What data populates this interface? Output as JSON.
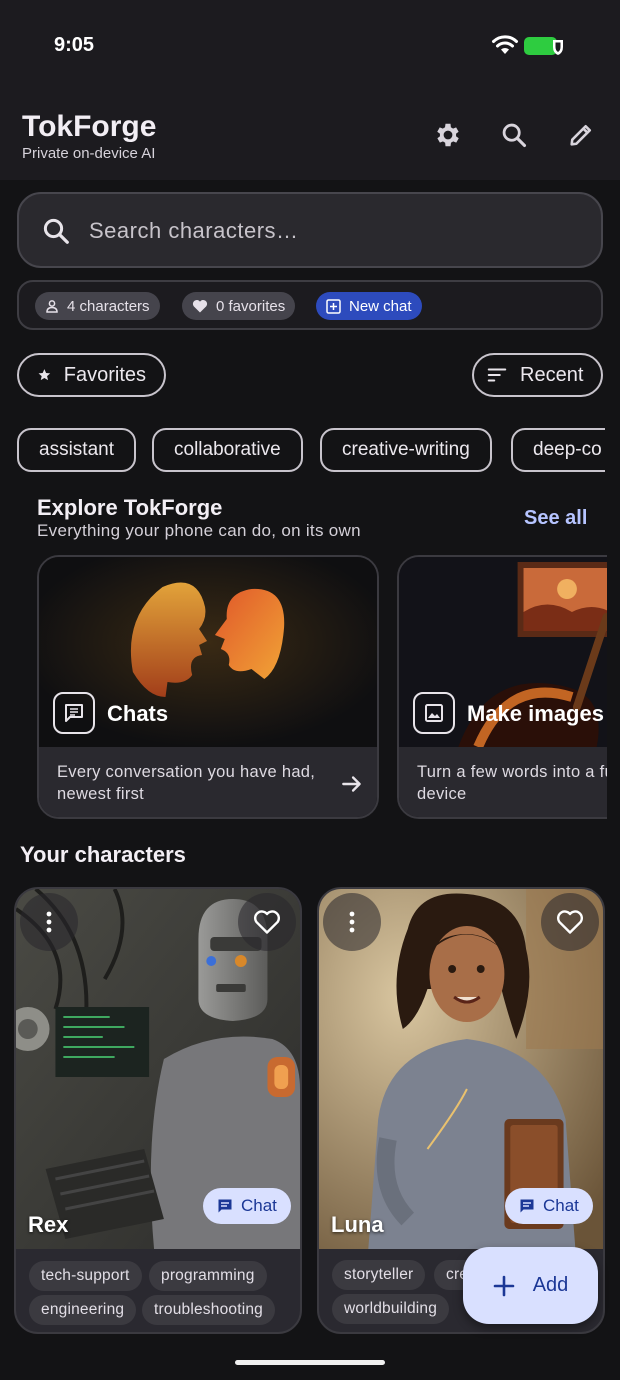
{
  "status_bar": {
    "time": "9:05"
  },
  "app_bar": {
    "title": "TokForge",
    "subtitle": "Private on-device AI",
    "actions": [
      "gear-icon",
      "search-icon",
      "edit-icon"
    ]
  },
  "search": {
    "placeholder": "Search characters…"
  },
  "stats": {
    "characters": "4 characters",
    "favorites": "0 favorites",
    "new_chat": "New chat"
  },
  "filters": {
    "favorites": "Favorites",
    "sort": "Recent"
  },
  "tags": [
    "assistant",
    "collaborative",
    "creative-writing",
    "deep-co"
  ],
  "explore": {
    "title": "Explore TokForge",
    "subtitle": "Everything your phone can do, on its own",
    "see_all": "See all",
    "cards": [
      {
        "label": "Chats",
        "desc": "Every conversation you have had, newest first",
        "icon": "chat-icon"
      },
      {
        "label": "Make images",
        "desc": "Turn a few words into a fully on-device",
        "icon": "image-icon"
      }
    ]
  },
  "characters_section": {
    "title": "Your characters"
  },
  "characters": [
    {
      "name": "Rex",
      "chat_label": "Chat",
      "tags": [
        "tech-support",
        "programming",
        "engineering",
        "troubleshooting"
      ]
    },
    {
      "name": "Luna",
      "chat_label": "Chat",
      "tags": [
        "storyteller",
        "cre",
        "worldbuilding"
      ]
    }
  ],
  "fab": {
    "label": "Add"
  },
  "colors": {
    "accent": "#2d4bbd",
    "chip_light": "#d9e0ff",
    "link": "#b6c4ff",
    "background": "#131315"
  }
}
